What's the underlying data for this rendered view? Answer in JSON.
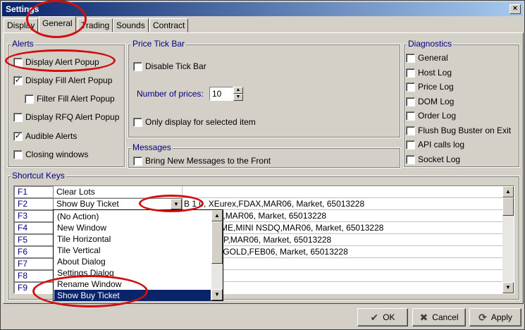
{
  "window": {
    "title": "Settings",
    "close": "×"
  },
  "tabs": [
    "Display",
    "General",
    "Trading",
    "Sounds",
    "Contract"
  ],
  "alerts": {
    "legend": "Alerts",
    "items": [
      {
        "label": "Display Alert Popup",
        "checked": false
      },
      {
        "label": "Display Fill Alert Popup",
        "checked": true
      },
      {
        "label": "Filter Fill Alert Popup",
        "checked": false
      },
      {
        "label": "Display RFQ Alert Popup",
        "checked": false
      },
      {
        "label": "Audible Alerts",
        "checked": true
      },
      {
        "label": "Closing windows",
        "checked": false
      }
    ]
  },
  "price_tick_bar": {
    "legend": "Price Tick Bar",
    "disable_label": "Disable Tick Bar",
    "num_prices_label": "Number of prices:",
    "num_prices_value": "10",
    "only_display_label": "Only display for selected item"
  },
  "messages": {
    "legend": "Messages",
    "bring_front_label": "Bring New Messages to the Front"
  },
  "diagnostics": {
    "legend": "Diagnostics",
    "items": [
      "General",
      "Host Log",
      "Price Log",
      "DOM Log",
      "Order Log",
      "Flush Bug Buster on Exit",
      "API calls log",
      "Socket Log"
    ]
  },
  "shortcut_keys": {
    "legend": "Shortcut Keys",
    "rows": [
      {
        "key": "F1",
        "action": "Clear Lots",
        "rest": ""
      },
      {
        "key": "F2",
        "action": "Show Buy Ticket",
        "rest": "B 1 0, XEurex,FDAX,MAR06, Market, 65013228"
      },
      {
        "key": "F3",
        "action": "",
        "rest": "E,Euro FX,MAR06, Market, 65013228"
      },
      {
        "key": "F4",
        "action": "",
        "rest": "764,00, CME,MINI NSDQ,MAR06, Market, 65013228"
      },
      {
        "key": "F5",
        "action": "",
        "rest": "E,MINI S&P,MAR06, Market, 65013228"
      },
      {
        "key": "F6",
        "action": "",
        "rest": "BOT,MINI GOLD,FEB06, Market, 65013228"
      },
      {
        "key": "F7",
        "action": "",
        "rest": ""
      },
      {
        "key": "F8",
        "action": "",
        "rest": ""
      },
      {
        "key": "F9",
        "action": "",
        "rest": ""
      }
    ],
    "dropdown_options": [
      "(No Action)",
      "New Window",
      "Tile Horizontal",
      "Tile Vertical",
      "About Dialog",
      "Settings Dialog",
      "Rename Window",
      "Show Buy Ticket"
    ],
    "dropdown_selected": "Show Buy Ticket"
  },
  "buttons": {
    "ok": "OK",
    "cancel": "Cancel",
    "apply": "Apply"
  },
  "colors": {
    "title_bar": "#0a246a",
    "legend_text": "#000080",
    "highlight_circle": "#d01010"
  }
}
